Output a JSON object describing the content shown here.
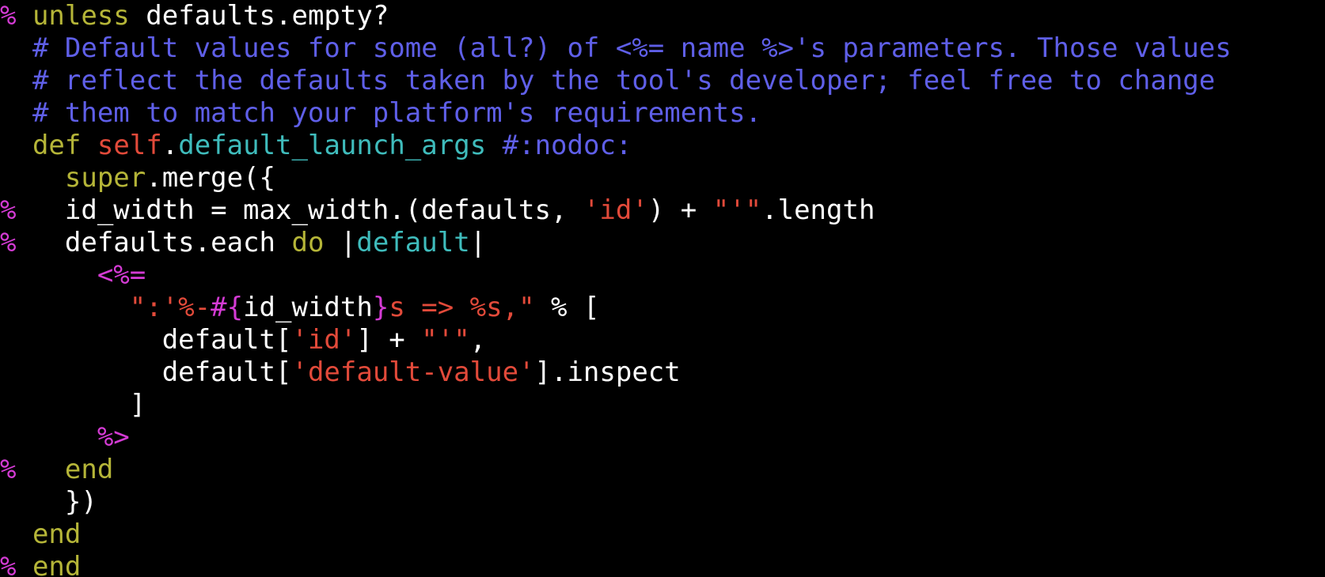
{
  "colors": {
    "background": "#000000",
    "text": "#ffffff",
    "percent_marker": "#d43bd4",
    "keyword": "#b5b538",
    "comment": "#5f5fe8",
    "string": "#e24a3a",
    "method": "#3fbcbc",
    "erb_tag": "#d43bd4"
  },
  "lines": [
    [
      {
        "t": "% ",
        "c": "t-pct"
      },
      {
        "t": "unless",
        "c": "t-kw"
      },
      {
        "t": " defaults.empty?",
        "c": "t-txt"
      }
    ],
    [
      {
        "t": "  # Default values for some (all?) of <%= name %>'s parameters. Those values",
        "c": "t-cm"
      }
    ],
    [
      {
        "t": "  # reflect the defaults taken by the tool's developer; feel free to change",
        "c": "t-cm"
      }
    ],
    [
      {
        "t": "  # them to match your platform's requirements.",
        "c": "t-cm"
      }
    ],
    [
      {
        "t": "  ",
        "c": "t-txt"
      },
      {
        "t": "def",
        "c": "t-kw"
      },
      {
        "t": " ",
        "c": "t-txt"
      },
      {
        "t": "self",
        "c": "t-self"
      },
      {
        "t": ".",
        "c": "t-txt"
      },
      {
        "t": "default_launch_args",
        "c": "t-meth"
      },
      {
        "t": " #:nodoc:",
        "c": "t-sym"
      }
    ],
    [
      {
        "t": "    ",
        "c": "t-txt"
      },
      {
        "t": "super",
        "c": "t-kw"
      },
      {
        "t": ".merge({",
        "c": "t-txt"
      }
    ],
    [
      {
        "t": "%",
        "c": "t-pct"
      },
      {
        "t": "   id_width = max_width.(defaults, ",
        "c": "t-txt"
      },
      {
        "t": "'id'",
        "c": "t-str"
      },
      {
        "t": ") + ",
        "c": "t-txt"
      },
      {
        "t": "\"'\"",
        "c": "t-str"
      },
      {
        "t": ".length",
        "c": "t-txt"
      }
    ],
    [
      {
        "t": "%",
        "c": "t-pct"
      },
      {
        "t": "   defaults.each ",
        "c": "t-txt"
      },
      {
        "t": "do",
        "c": "t-kw"
      },
      {
        "t": " |",
        "c": "t-txt"
      },
      {
        "t": "default",
        "c": "t-meth"
      },
      {
        "t": "|",
        "c": "t-txt"
      }
    ],
    [
      {
        "t": "      ",
        "c": "t-txt"
      },
      {
        "t": "<%=",
        "c": "t-erb"
      }
    ],
    [
      {
        "t": "        ",
        "c": "t-txt"
      },
      {
        "t": "\":'%-",
        "c": "t-str"
      },
      {
        "t": "#{",
        "c": "t-erb"
      },
      {
        "t": "id_width",
        "c": "t-txt"
      },
      {
        "t": "}",
        "c": "t-erb"
      },
      {
        "t": "s => %s,\"",
        "c": "t-str"
      },
      {
        "t": " % [",
        "c": "t-txt"
      }
    ],
    [
      {
        "t": "          default[",
        "c": "t-txt"
      },
      {
        "t": "'id'",
        "c": "t-str"
      },
      {
        "t": "] + ",
        "c": "t-txt"
      },
      {
        "t": "\"'\"",
        "c": "t-str"
      },
      {
        "t": ",",
        "c": "t-txt"
      }
    ],
    [
      {
        "t": "          default[",
        "c": "t-txt"
      },
      {
        "t": "'default-value'",
        "c": "t-str"
      },
      {
        "t": "].inspect",
        "c": "t-txt"
      }
    ],
    [
      {
        "t": "        ]",
        "c": "t-txt"
      }
    ],
    [
      {
        "t": "      ",
        "c": "t-txt"
      },
      {
        "t": "%>",
        "c": "t-erb"
      }
    ],
    [
      {
        "t": "%",
        "c": "t-pct"
      },
      {
        "t": "   ",
        "c": "t-txt"
      },
      {
        "t": "end",
        "c": "t-kw"
      }
    ],
    [
      {
        "t": "    })",
        "c": "t-txt"
      }
    ],
    [
      {
        "t": "  ",
        "c": "t-txt"
      },
      {
        "t": "end",
        "c": "t-kw"
      }
    ],
    [
      {
        "t": "% ",
        "c": "t-pct"
      },
      {
        "t": "end",
        "c": "t-kw"
      }
    ]
  ]
}
